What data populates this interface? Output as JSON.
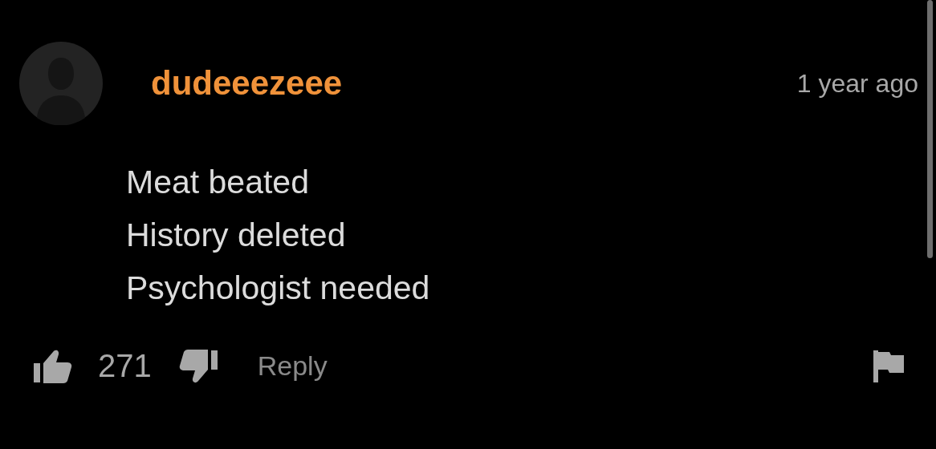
{
  "comment": {
    "username": "dudeeezeee",
    "time": "1 year ago",
    "lines": [
      "Meat beated",
      "History deleted",
      "Psychologist needed"
    ],
    "likes": "271",
    "reply": "Reply"
  }
}
